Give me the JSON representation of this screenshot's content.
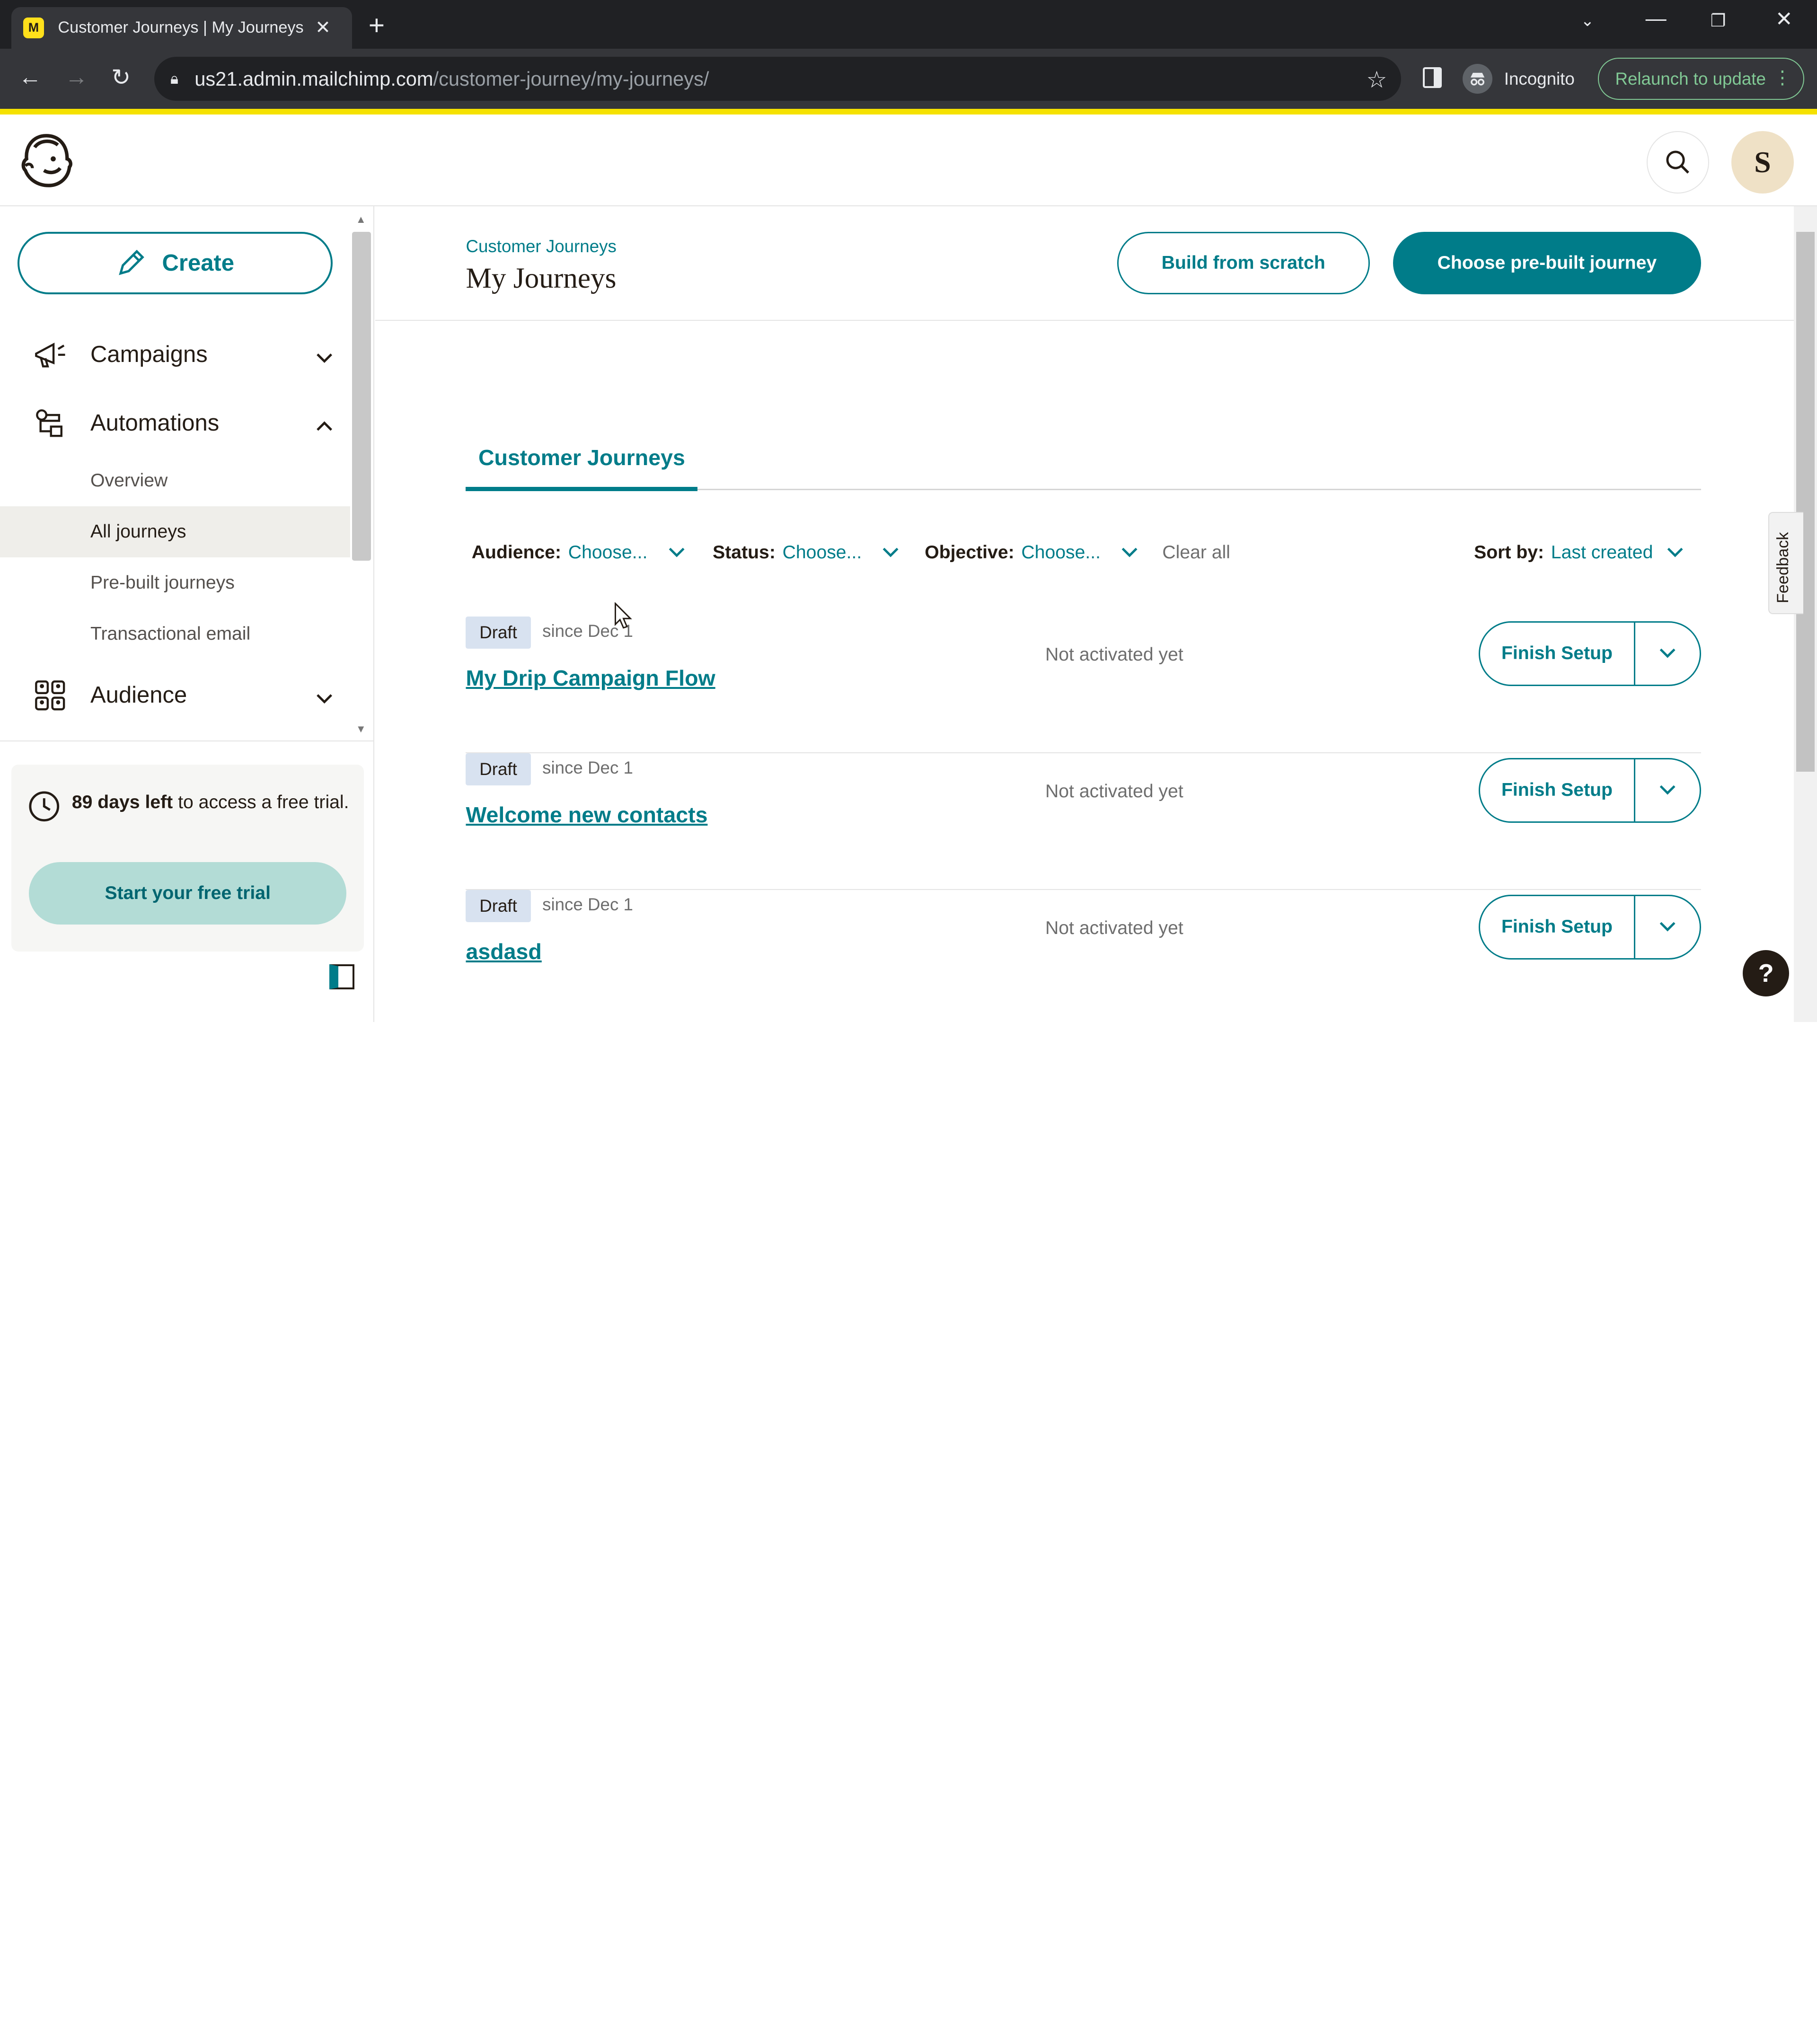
{
  "browser": {
    "tab_title": "Customer Journeys | My Journeys",
    "tab_favicon_letter": "M",
    "url_host": "us21.admin.mailchimp.com",
    "url_path": "/customer-journey/my-journeys/",
    "incognito_label": "Incognito",
    "relaunch_label": "Relaunch to update"
  },
  "header": {
    "avatar_initial": "S"
  },
  "sidebar": {
    "create_label": "Create",
    "items": [
      {
        "label": "Campaigns",
        "icon": "megaphone-icon",
        "expanded": false
      },
      {
        "label": "Automations",
        "icon": "automation-icon",
        "expanded": true
      },
      {
        "label": "Audience",
        "icon": "audience-icon",
        "expanded": false
      }
    ],
    "sub_items": [
      {
        "label": "Overview",
        "active": false
      },
      {
        "label": "All journeys",
        "active": true
      },
      {
        "label": "Pre-built journeys",
        "active": false
      },
      {
        "label": "Transactional email",
        "active": false
      }
    ],
    "trial": {
      "days_bold": "89 days left",
      "text": "to access a free trial.",
      "button_label": "Start your free trial"
    }
  },
  "page": {
    "breadcrumb": "Customer Journeys",
    "title": "My Journeys",
    "build_from_scratch": "Build from scratch",
    "choose_prebuilt": "Choose pre-built journey",
    "tab_label": "Customer Journeys"
  },
  "filters": {
    "audience_label": "Audience:",
    "audience_value": "Choose...",
    "status_label": "Status:",
    "status_value": "Choose...",
    "objective_label": "Objective:",
    "objective_value": "Choose...",
    "clear_all": "Clear all",
    "sort_label": "Sort by:",
    "sort_value": "Last created"
  },
  "journeys": [
    {
      "badge": "Draft",
      "since": "since Dec 1",
      "name": "My Drip Campaign Flow",
      "status": "Not activated yet",
      "action": "Finish Setup"
    },
    {
      "badge": "Draft",
      "since": "since Dec 1",
      "name": "Welcome new contacts",
      "status": "Not activated yet",
      "action": "Finish Setup"
    },
    {
      "badge": "Draft",
      "since": "since Dec 1",
      "name": "asdasd",
      "status": "Not activated yet",
      "action": "Finish Setup"
    }
  ],
  "feedback_label": "Feedback",
  "help_label": "?",
  "colors": {
    "brand_teal": "#007c89",
    "brand_yellow": "#ffe01b",
    "draft_badge": "#d8e2f0",
    "trial_button": "#b3dcd6"
  }
}
